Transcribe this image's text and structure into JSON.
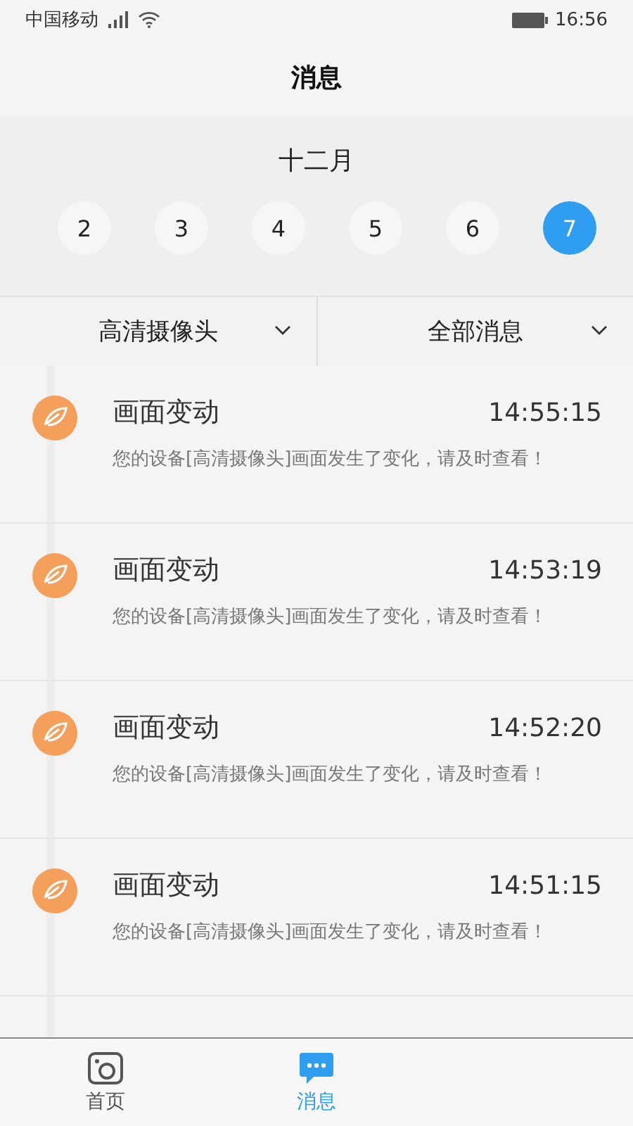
{
  "status_bar": {
    "carrier": "中国移动",
    "time": "16:56"
  },
  "header": {
    "title": "消息"
  },
  "calendar": {
    "month": "十二月",
    "days": [
      {
        "label": "2",
        "selected": false
      },
      {
        "label": "3",
        "selected": false
      },
      {
        "label": "4",
        "selected": false
      },
      {
        "label": "5",
        "selected": false
      },
      {
        "label": "6",
        "selected": false
      },
      {
        "label": "7",
        "selected": true
      }
    ]
  },
  "filters": [
    {
      "label": "高清摄像头"
    },
    {
      "label": "全部消息"
    }
  ],
  "messages": [
    {
      "title": "画面变动",
      "time": "14:55:15",
      "body": "您的设备[高清摄像头]画面发生了变化，请及时查看！"
    },
    {
      "title": "画面变动",
      "time": "14:53:19",
      "body": "您的设备[高清摄像头]画面发生了变化，请及时查看！"
    },
    {
      "title": "画面变动",
      "time": "14:52:20",
      "body": "您的设备[高清摄像头]画面发生了变化，请及时查看！"
    },
    {
      "title": "画面变动",
      "time": "14:51:15",
      "body": "您的设备[高清摄像头]画面发生了变化，请及时查看！"
    }
  ],
  "tab_bar": [
    {
      "label": "首页",
      "kind": "camera",
      "selected": false
    },
    {
      "label": "消息",
      "kind": "chat",
      "selected": true
    }
  ]
}
